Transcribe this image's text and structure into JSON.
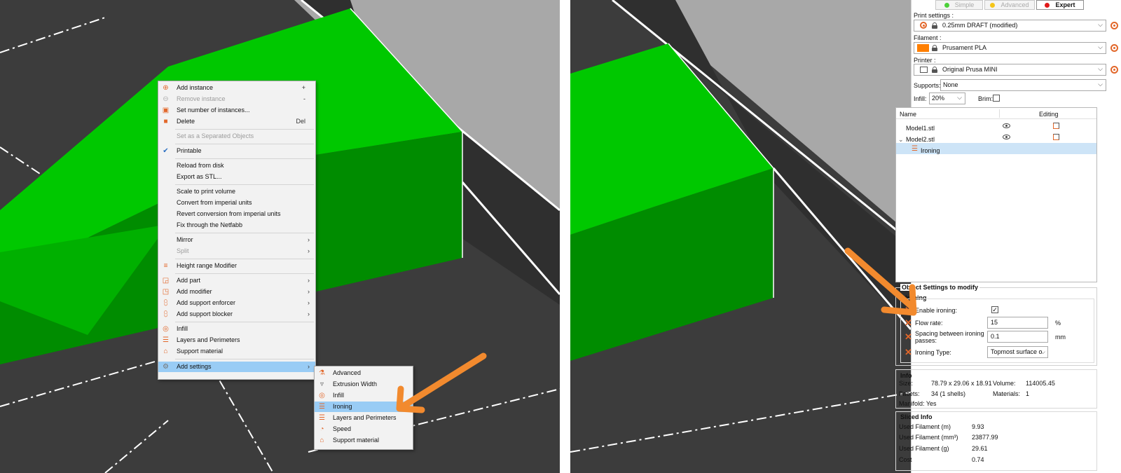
{
  "context_menu": {
    "items": [
      {
        "label": "Add instance",
        "accel": "+",
        "icon": "add-instance-icon"
      },
      {
        "label": "Remove instance",
        "accel": "-",
        "icon": "remove-instance-icon"
      },
      {
        "label": "Set number of instances...",
        "icon": "instances-icon"
      },
      {
        "label": "Delete",
        "accel": "Del",
        "icon": "delete-icon"
      },
      {
        "label": "Set as a Separated Objects"
      },
      {
        "label": "Printable",
        "icon": "checkmark-icon"
      },
      {
        "label": "Reload from disk"
      },
      {
        "label": "Export as STL..."
      },
      {
        "label": "Scale to print volume"
      },
      {
        "label": "Convert from imperial units"
      },
      {
        "label": "Revert conversion from imperial units"
      },
      {
        "label": "Fix through the Netfabb"
      },
      {
        "label": "Mirror"
      },
      {
        "label": "Split"
      },
      {
        "label": "Height range Modifier",
        "icon": "height-range-icon"
      },
      {
        "label": "Add part",
        "icon": "add-part-icon"
      },
      {
        "label": "Add modifier",
        "icon": "add-modifier-icon"
      },
      {
        "label": "Add support enforcer",
        "icon": "support-enforcer-icon"
      },
      {
        "label": "Add support blocker",
        "icon": "support-blocker-icon"
      },
      {
        "label": "Infill",
        "icon": "infill-icon"
      },
      {
        "label": "Layers and Perimeters",
        "icon": "layers-icon"
      },
      {
        "label": "Support material",
        "icon": "support-icon"
      },
      {
        "label": "Add settings",
        "icon": "settings-icon"
      }
    ]
  },
  "submenu": {
    "items": [
      {
        "label": "Advanced",
        "icon": "advanced-icon"
      },
      {
        "label": "Extrusion Width",
        "icon": "extrusion-width-icon"
      },
      {
        "label": "Infill",
        "icon": "infill-icon"
      },
      {
        "label": "Ironing",
        "icon": "ironing-icon"
      },
      {
        "label": "Layers and Perimeters",
        "icon": "layers-icon"
      },
      {
        "label": "Speed",
        "icon": "speed-icon"
      },
      {
        "label": "Support material",
        "icon": "support-icon"
      }
    ]
  },
  "panel": {
    "modes": {
      "simple": "Simple",
      "advanced": "Advanced",
      "expert": "Expert"
    },
    "mode_colors": {
      "simple": "#4cd039",
      "advanced": "#f5c518",
      "expert": "#e01919"
    },
    "print_settings_label": "Print settings :",
    "print_settings_value": "0.25mm DRAFT (modified)",
    "filament_label": "Filament :",
    "filament_value": "Prusament PLA",
    "filament_color": "#ff7f00",
    "printer_label": "Printer :",
    "printer_value": "Original Prusa MINI",
    "supports_label": "Supports:",
    "supports_value": "None",
    "infill_label": "Infill:",
    "infill_value": "20%",
    "brim_label": "Brim:",
    "tree": {
      "col_name": "Name",
      "col_editing": "Editing",
      "rows": [
        "Model1.stl",
        "Model2.stl",
        "Ironing"
      ]
    },
    "object_settings": {
      "title": "Object Settings to modify",
      "group": "Ironing",
      "enable_label": "Enable ironing:",
      "flow_label": "Flow rate:",
      "flow_value": "15",
      "flow_unit": "%",
      "spacing_label_1": "Spacing between ironing",
      "spacing_label_2": "passes:",
      "spacing_value": "0.1",
      "spacing_unit": "mm",
      "type_label": "Ironing Type:",
      "type_value": "Topmost surface o"
    },
    "info": {
      "title": "Info",
      "size_label": "Size:",
      "size_value": "78.79 x 29.06 x 18.91",
      "volume_label": "Volume:",
      "volume_value": "114005.45",
      "facets_label": "Facets:",
      "facets_value": "34 (1 shells)",
      "materials_label": "Materials:",
      "materials_value": "1",
      "manifold": "Manifold: Yes"
    },
    "sliced_info": {
      "title": "Sliced Info",
      "rows": [
        {
          "label": "Used Filament (m)",
          "value": "9.93"
        },
        {
          "label": "Used Filament (mm³)",
          "value": "23877.99"
        },
        {
          "label": "Used Filament (g)",
          "value": "29.61"
        },
        {
          "label": "Cost",
          "value": "0.74"
        }
      ]
    }
  },
  "colors": {
    "accent_orange": "#f28a2e",
    "model_green": "#00c800",
    "bed_gray": "#3c3c3c",
    "highlight_blue": "#99ccf5"
  }
}
